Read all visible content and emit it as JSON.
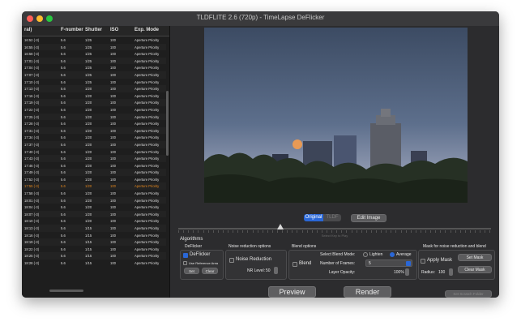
{
  "window": {
    "title": "TLDFLITE 2.6 (720p) - TimeLapse DeFlicker"
  },
  "table": {
    "columns": [
      "ral)",
      "F-number",
      "Shutter",
      "ISO",
      "Exp. Mode"
    ],
    "rows": [
      [
        "16:52 (-3)",
        "5.6",
        "1/25",
        "100",
        "Aperture Priority"
      ],
      [
        "16:55 (-3)",
        "5.6",
        "1/25",
        "100",
        "Aperture Priority"
      ],
      [
        "16:58 (-3)",
        "5.6",
        "1/25",
        "100",
        "Aperture Priority"
      ],
      [
        "17:01 (-3)",
        "5.6",
        "1/25",
        "100",
        "Aperture Priority"
      ],
      [
        "17:04 (-3)",
        "5.6",
        "1/25",
        "100",
        "Aperture Priority"
      ],
      [
        "17:07 (-3)",
        "5.6",
        "1/25",
        "100",
        "Aperture Priority"
      ],
      [
        "17:10 (-3)",
        "5.6",
        "1/25",
        "100",
        "Aperture Priority"
      ],
      [
        "17:13 (-3)",
        "5.6",
        "1/20",
        "100",
        "Aperture Priority"
      ],
      [
        "17:16 (-3)",
        "5.6",
        "1/20",
        "100",
        "Aperture Priority"
      ],
      [
        "17:19 (-3)",
        "5.6",
        "1/20",
        "100",
        "Aperture Priority"
      ],
      [
        "17:22 (-3)",
        "5.6",
        "1/20",
        "100",
        "Aperture Priority"
      ],
      [
        "17:25 (-3)",
        "5.6",
        "1/20",
        "100",
        "Aperture Priority"
      ],
      [
        "17:28 (-3)",
        "5.6",
        "1/20",
        "100",
        "Aperture Priority"
      ],
      [
        "17:31 (-3)",
        "5.6",
        "1/20",
        "100",
        "Aperture Priority"
      ],
      [
        "17:34 (-3)",
        "5.6",
        "1/20",
        "100",
        "Aperture Priority"
      ],
      [
        "17:37 (-3)",
        "5.6",
        "1/20",
        "100",
        "Aperture Priority"
      ],
      [
        "17:40 (-3)",
        "5.6",
        "1/20",
        "100",
        "Aperture Priority"
      ],
      [
        "17:43 (-3)",
        "5.6",
        "1/20",
        "100",
        "Aperture Priority"
      ],
      [
        "17:46 (-3)",
        "5.6",
        "1/20",
        "100",
        "Aperture Priority"
      ],
      [
        "17:49 (-3)",
        "5.6",
        "1/20",
        "100",
        "Aperture Priority"
      ],
      [
        "17:52 (-3)",
        "5.6",
        "1/20",
        "100",
        "Aperture Priority"
      ],
      [
        "17:55 (-3)",
        "5.6",
        "1/20",
        "100",
        "Aperture Priority"
      ],
      [
        "17:58 (-3)",
        "5.6",
        "1/20",
        "100",
        "Aperture Priority"
      ],
      [
        "18:01 (-3)",
        "5.6",
        "1/20",
        "100",
        "Aperture Priority"
      ],
      [
        "18:04 (-3)",
        "5.6",
        "1/20",
        "100",
        "Aperture Priority"
      ],
      [
        "18:07 (-3)",
        "5.6",
        "1/20",
        "100",
        "Aperture Priority"
      ],
      [
        "18:10 (-3)",
        "5.6",
        "1/20",
        "100",
        "Aperture Priority"
      ],
      [
        "18:13 (-3)",
        "5.6",
        "1/15",
        "100",
        "Aperture Priority"
      ],
      [
        "18:16 (-3)",
        "5.6",
        "1/15",
        "100",
        "Aperture Priority"
      ],
      [
        "18:19 (-3)",
        "5.6",
        "1/15",
        "100",
        "Aperture Priority"
      ],
      [
        "18:22 (-3)",
        "5.6",
        "1/15",
        "100",
        "Aperture Priority"
      ],
      [
        "18:25 (-3)",
        "5.6",
        "1/15",
        "100",
        "Aperture Priority"
      ],
      [
        "18:28 (-3)",
        "5.6",
        "1/15",
        "100",
        "Aperture Priority"
      ]
    ],
    "highlight_row_index": 21,
    "highlight_color": "#e0851e"
  },
  "view": {
    "original_label": "Original",
    "tldf_label": "TLDF",
    "edit_image_label": "Edit Image",
    "slider_hint": "Select Key to Play"
  },
  "algorithms": {
    "section_label": "Algorithms",
    "deflicker": {
      "title": "DeFlicker",
      "checkbox_label": "DeFlicker",
      "checked": true,
      "ref_area_label": "Use Reference Area",
      "set_label": "Set",
      "clear_label": "Clear"
    },
    "noise": {
      "title": "Noise reduction options",
      "checkbox_label": "Noise Reduction",
      "nr_level_label": "NR Level:",
      "nr_level_value": "50"
    },
    "blend": {
      "title": "Blend options",
      "checkbox_label": "Blend",
      "mode_label": "Select Blend Mode:",
      "lighten_label": "Lighten",
      "average_label": "Average",
      "selected_mode": "Average",
      "frames_label": "Number of Frames:",
      "frames_value": "5",
      "opacity_label": "Layer Opacity:",
      "opacity_value": "100%"
    },
    "mask": {
      "title": "Mask for noise reduction and blend",
      "checkbox_label": "Apply Mask",
      "set_mask_label": "Set Mask",
      "clear_mask_label": "Clear Mask",
      "radius_label": "Radius:",
      "radius_value": "100"
    }
  },
  "actions": {
    "preview_label": "Preview",
    "render_label": "Render",
    "scratch_label": "Set Scratch Folder"
  },
  "colors": {
    "accent": "#2a67d6",
    "window_bg": "#2c2c2e"
  }
}
